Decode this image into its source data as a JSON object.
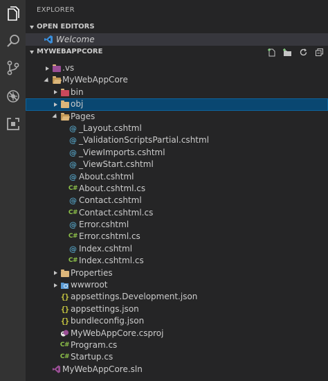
{
  "activity_bar": {
    "items": [
      {
        "name": "explorer-icon"
      },
      {
        "name": "search-icon"
      },
      {
        "name": "source-control-icon"
      },
      {
        "name": "debug-icon"
      },
      {
        "name": "extensions-icon"
      }
    ]
  },
  "sidebar": {
    "title": "EXPLORER",
    "open_editors": {
      "title": "OPEN EDITORS",
      "items": [
        {
          "label": "Welcome",
          "icon": "vscode-icon"
        }
      ]
    },
    "workspace": {
      "title": "MYWEBAPPCORE",
      "actions": [
        "new-file-icon",
        "new-folder-icon",
        "refresh-icon",
        "collapse-all-icon"
      ],
      "tree": [
        {
          "label": ".vs",
          "depth": 0,
          "type": "folder",
          "expanded": false,
          "icon": "vs-folder-icon"
        },
        {
          "label": "MyWebAppCore",
          "depth": 0,
          "type": "folder",
          "expanded": true,
          "icon": "folder-open-icon"
        },
        {
          "label": "bin",
          "depth": 1,
          "type": "folder",
          "expanded": false,
          "icon": "bin-folder-icon"
        },
        {
          "label": "obj",
          "depth": 1,
          "type": "folder",
          "expanded": false,
          "icon": "folder-icon",
          "selected": true
        },
        {
          "label": "Pages",
          "depth": 1,
          "type": "folder",
          "expanded": true,
          "icon": "folder-open-icon"
        },
        {
          "label": "_Layout.cshtml",
          "depth": 2,
          "type": "file",
          "icon": "razor-icon"
        },
        {
          "label": "_ValidationScriptsPartial.cshtml",
          "depth": 2,
          "type": "file",
          "icon": "razor-icon"
        },
        {
          "label": "_ViewImports.cshtml",
          "depth": 2,
          "type": "file",
          "icon": "razor-icon"
        },
        {
          "label": "_ViewStart.cshtml",
          "depth": 2,
          "type": "file",
          "icon": "razor-icon"
        },
        {
          "label": "About.cshtml",
          "depth": 2,
          "type": "file",
          "icon": "razor-icon"
        },
        {
          "label": "About.cshtml.cs",
          "depth": 2,
          "type": "file",
          "icon": "csharp-icon"
        },
        {
          "label": "Contact.cshtml",
          "depth": 2,
          "type": "file",
          "icon": "razor-icon"
        },
        {
          "label": "Contact.cshtml.cs",
          "depth": 2,
          "type": "file",
          "icon": "csharp-icon"
        },
        {
          "label": "Error.cshtml",
          "depth": 2,
          "type": "file",
          "icon": "razor-icon"
        },
        {
          "label": "Error.cshtml.cs",
          "depth": 2,
          "type": "file",
          "icon": "csharp-icon"
        },
        {
          "label": "Index.cshtml",
          "depth": 2,
          "type": "file",
          "icon": "razor-icon"
        },
        {
          "label": "Index.cshtml.cs",
          "depth": 2,
          "type": "file",
          "icon": "csharp-icon"
        },
        {
          "label": "Properties",
          "depth": 1,
          "type": "folder",
          "expanded": false,
          "icon": "folder-icon"
        },
        {
          "label": "wwwroot",
          "depth": 1,
          "type": "folder",
          "expanded": false,
          "icon": "www-folder-icon"
        },
        {
          "label": "appsettings.Development.json",
          "depth": 1,
          "type": "file",
          "icon": "json-icon"
        },
        {
          "label": "appsettings.json",
          "depth": 1,
          "type": "file",
          "icon": "json-icon"
        },
        {
          "label": "bundleconfig.json",
          "depth": 1,
          "type": "file",
          "icon": "json-icon"
        },
        {
          "label": "MyWebAppCore.csproj",
          "depth": 1,
          "type": "file",
          "icon": "csproj-icon"
        },
        {
          "label": "Program.cs",
          "depth": 1,
          "type": "file",
          "icon": "csharp-icon"
        },
        {
          "label": "Startup.cs",
          "depth": 1,
          "type": "file",
          "icon": "csharp-icon"
        },
        {
          "label": "MyWebAppCore.sln",
          "depth": 0,
          "type": "file",
          "icon": "vs-solution-icon"
        }
      ]
    }
  },
  "colors": {
    "activity_bar": "#333333",
    "sidebar": "#252526",
    "selection": "#094771",
    "folder": "#dcb67a",
    "razor": "#519aba",
    "csharp": "#8dc149",
    "json": "#cbcb41",
    "vs_purple": "#9b4f96"
  }
}
